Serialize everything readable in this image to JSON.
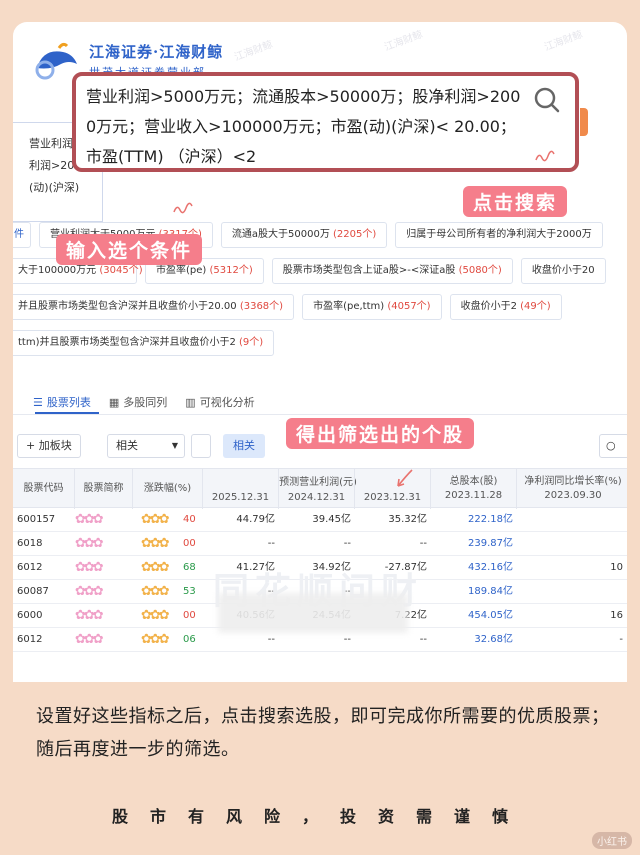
{
  "brand": {
    "line1": "江海证券·江海财鲸",
    "line2": "世茂大道证券营业部"
  },
  "watermark": "江海财鲸",
  "bg_search_lines": [
    "营业利润>",
    "利润>2000",
    "(动)(沪深)"
  ],
  "search": {
    "query": "营业利润>5000万元；流通股本>50000万；股净利润>2000万元；营业收入>100000万元；市盈(动)(沪深)< 20.00；市盈(TTM) （沪深）<2"
  },
  "labels": {
    "search_click": "点击搜索",
    "input_conditions": "输入选个条件",
    "result_stocks": "得出筛选出的个股"
  },
  "chips_row1": [
    {
      "text": "件",
      "count": ""
    },
    {
      "text": "营业利润大于5000万元 ",
      "count": "(3317个)"
    },
    {
      "text": "流通a股大于50000万 ",
      "count": "(2205个)"
    },
    {
      "text": "归属于母公司所有者的净利润大于2000万",
      "count": ""
    }
  ],
  "chips_row2": [
    {
      "text": "大于100000万元 ",
      "count": "(3045个)"
    },
    {
      "text": "市盈率(pe) ",
      "count": "(5312个)"
    },
    {
      "text": "股票市场类型包含上证a股>-<深证a股 ",
      "count": "(5080个)"
    },
    {
      "text": "收盘价小于20",
      "count": ""
    }
  ],
  "chips_row3": [
    {
      "text": "并且股票市场类型包含沪深并且收盘价小于20.00 ",
      "count": "(3368个)"
    },
    {
      "text": "市盈率(pe,ttm) ",
      "count": "(4057个)"
    },
    {
      "text": "收盘价小于2 ",
      "count": "(49个)"
    }
  ],
  "chips_row4": [
    {
      "text": "ttm)并且股票市场类型包含沪深并且收盘价小于2 ",
      "count": "(9个)"
    }
  ],
  "tabs": [
    {
      "icon": "list-icon",
      "label": "股票列表"
    },
    {
      "icon": "grid-icon",
      "label": "多股同列"
    },
    {
      "icon": "bar-chart-icon",
      "label": "可视化分析"
    }
  ],
  "toolbar": {
    "add_label": "+ 加板块",
    "sort_value": "相关",
    "related_label": "相关"
  },
  "table": {
    "group_header": "预测营业利润(元)",
    "headers": {
      "code": "股票代码",
      "name": "股票简称",
      "change": "涨跌幅(%)",
      "p1": "2025.12.31",
      "p2": "2024.12.31",
      "p3": "2023.12.31",
      "shares": "总股本(股)",
      "shares_date": "2023.11.28",
      "growth": "净利润同比增长率(%)",
      "growth_date": "2023.09.30"
    },
    "rows": [
      {
        "code": "600157",
        "change_tail": "40",
        "p1": "44.79亿",
        "p2": "39.45亿",
        "p3": "35.32亿",
        "shares": "222.18亿",
        "growth": ""
      },
      {
        "code": "6018",
        "change_tail": "00",
        "p1": "--",
        "p2": "--",
        "p3": "--",
        "shares": "239.87亿",
        "growth": ""
      },
      {
        "code": "6012",
        "change_tail": "68",
        "p1": "41.27亿",
        "p2": "34.92亿",
        "p3": "-27.87亿",
        "shares": "432.16亿",
        "growth": "10"
      },
      {
        "code": "60087",
        "change_tail": "53",
        "p1": "--",
        "p2": "--",
        "p3": "",
        "shares": "189.84亿",
        "growth": ""
      },
      {
        "code": "6000",
        "change_tail": "00",
        "p1": "40.56亿",
        "p2": "24.54亿",
        "p3": "7.22亿",
        "shares": "454.05亿",
        "growth": "16"
      },
      {
        "code": "6012",
        "change_tail": "06",
        "p1": "--",
        "p2": "--",
        "p3": "--",
        "shares": "32.68亿",
        "growth": "-"
      }
    ]
  },
  "ghost_text": "同花顺问财",
  "caption": "设置好这些指标之后，点击搜索选股，即可完成你所需要的优质股票；随后再度进一步的筛选。",
  "footer": "股市有风险，投资需谨慎",
  "corner_tag": "小红书"
}
